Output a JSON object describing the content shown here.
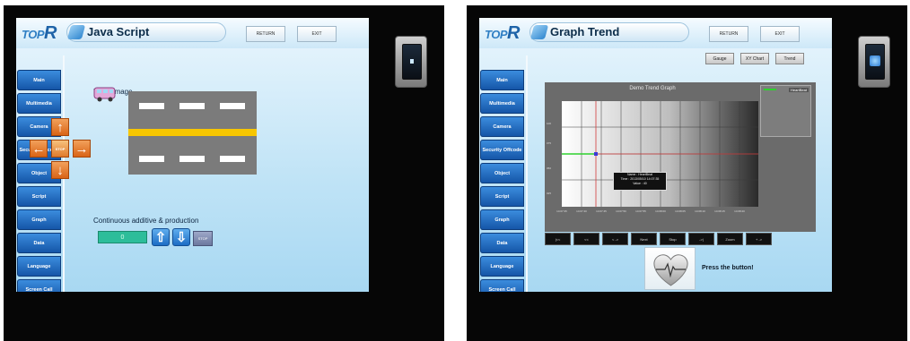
{
  "left_panel": {
    "logo": {
      "text": "TOP",
      "mark": "R"
    },
    "title": "Java Script",
    "header_buttons": {
      "return": "RETURN",
      "exit": "EXIT"
    },
    "sidebar": {
      "items": [
        {
          "label": "Main"
        },
        {
          "label": "Multimedia"
        },
        {
          "label": "Camera"
        },
        {
          "label": "Security Offcode"
        },
        {
          "label": "Object"
        },
        {
          "label": "Script"
        },
        {
          "label": "Graph"
        },
        {
          "label": "Data"
        },
        {
          "label": "Language"
        },
        {
          "label": "Screen Call"
        }
      ]
    },
    "move_image_label": "Move image",
    "dpad": {
      "stop_label": "STOP"
    },
    "continuous_label": "Continuous additive & production",
    "counter_value": "0",
    "stop_button_label": "STOP"
  },
  "right_panel": {
    "logo": {
      "text": "TOP",
      "mark": "R"
    },
    "title": "Graph Trend",
    "header_buttons": {
      "return": "RETURN",
      "exit": "EXIT"
    },
    "sub_buttons": [
      "Gauge",
      "XY Chart",
      "Trend"
    ],
    "sidebar": {
      "items": [
        {
          "label": "Main"
        },
        {
          "label": "Multimedia"
        },
        {
          "label": "Camera"
        },
        {
          "label": "Security Offcode"
        },
        {
          "label": "Object"
        },
        {
          "label": "Script"
        },
        {
          "label": "Graph"
        },
        {
          "label": "Data"
        },
        {
          "label": "Language"
        },
        {
          "label": "Screen Call"
        }
      ]
    },
    "graph": {
      "title": "Demo Trend Graph",
      "legend_entry": "HeartBeat",
      "tooltip": {
        "line1": "Name : HeartBeat",
        "line2": "Time : 2013/05/10 14:07:35",
        "line3": "Value : 40"
      },
      "y_ticks": [
        "100",
        "075",
        "050",
        "025"
      ],
      "x_ticks": [
        "14:07:35",
        "14:07:40",
        "14:07:45",
        "14:07:50",
        "14:07:55",
        "14:08:00",
        "14:08:05",
        "14:08:10",
        "14:08:15",
        "14:08:20"
      ]
    },
    "graph_buttons": [
      "|<<",
      "<<",
      "< ->",
      "Next",
      "Stop",
      "->|",
      "Zoom",
      "+ ->"
    ],
    "press_label": "Press the button!"
  },
  "colors": {
    "sidebar": "#1353a5",
    "background_top": "#eaf6fd",
    "background_bottom": "#a8d8f2",
    "road": "#7b7b7b",
    "road_yellow": "#f7c600",
    "dpad_orange": "#e07b2d",
    "counter": "#2dbd9a",
    "trend_line": "#2ed12e",
    "cursor_line": "#d23b3b"
  },
  "icons": {
    "dpad": [
      "arrow-up-icon",
      "arrow-left-icon",
      "arrow-right-icon",
      "arrow-down-icon"
    ],
    "bus": "bus-icon",
    "heart": "heart-ecg-icon",
    "counter_buttons": [
      "arrow-up-icon",
      "arrow-down-icon"
    ],
    "device_switch": "power-switch-icon"
  }
}
